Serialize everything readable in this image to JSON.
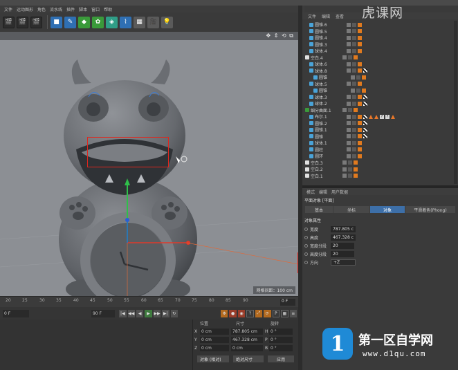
{
  "menu": [
    "文件",
    "运动图形",
    "角色",
    "流水线",
    "插件",
    "脚本",
    "窗口",
    "帮助"
  ],
  "toolbar_icons": [
    "render-view-icon",
    "render-settings-icon",
    "render-picture-viewer-icon",
    "cube-icon",
    "pen-icon",
    "subdivision-icon",
    "array-icon",
    "deformer-icon",
    "scene-icon",
    "camera-icon",
    "light-icon"
  ],
  "viewport": {
    "nav_icons": "✥ ⇕ ⟲ ⧉",
    "grid_label": "网格间距：100 cm"
  },
  "timeline": {
    "ticks": [
      "20",
      "25",
      "30",
      "35",
      "40",
      "45",
      "50",
      "55",
      "60",
      "65",
      "70",
      "75",
      "80",
      "85",
      "90"
    ],
    "frame": "0 F"
  },
  "transport": {
    "start": "0 F",
    "end": "90 F",
    "buttons": [
      "|◀",
      "◀◀",
      "◀",
      "▶",
      "▶▶",
      "▶|",
      "↻"
    ]
  },
  "coordinates": {
    "headers": {
      "position": "位置",
      "size": "尺寸",
      "rotation": "旋转"
    },
    "rows": [
      {
        "axis": "X",
        "pos": "0 cm",
        "size": "787.805 cm",
        "rot_axis": "H",
        "rot": "0 °"
      },
      {
        "axis": "Y",
        "pos": "0 cm",
        "size": "467.328 cm",
        "rot_axis": "P",
        "rot": "0 °"
      },
      {
        "axis": "Z",
        "pos": "0 cm",
        "size": "0 cm",
        "rot_axis": "B",
        "rot": "0 °"
      }
    ],
    "mode": "对象 (相对)",
    "size_mode": "绝对尺寸",
    "apply": "应用"
  },
  "object_manager": {
    "tabs": [
      "文件",
      "编辑",
      "查看"
    ],
    "rows": [
      {
        "name": "圆锥.6",
        "indent": 1,
        "color": "#4aa3d8",
        "extra": []
      },
      {
        "name": "圆锥.5",
        "indent": 1,
        "color": "#4aa3d8",
        "extra": []
      },
      {
        "name": "圆锥.4",
        "indent": 1,
        "color": "#4aa3d8",
        "extra": []
      },
      {
        "name": "圆锥.3",
        "indent": 1,
        "color": "#4aa3d8",
        "extra": []
      },
      {
        "name": "球体.4",
        "indent": 1,
        "color": "#4aa3d8",
        "extra": []
      },
      {
        "name": "空白.4",
        "indent": 0,
        "color": "#e0e0e0",
        "extra": []
      },
      {
        "name": "球体.6",
        "indent": 1,
        "color": "#4aa3d8",
        "extra": []
      },
      {
        "name": "球体.8",
        "indent": 1,
        "color": "#4aa3d8",
        "extra": [
          "checker"
        ]
      },
      {
        "name": "圆锥",
        "indent": 2,
        "color": "#4aa3d8",
        "extra": []
      },
      {
        "name": "球体.5",
        "indent": 1,
        "color": "#4aa3d8",
        "extra": []
      },
      {
        "name": "圆锥",
        "indent": 2,
        "color": "#4aa3d8",
        "extra": []
      },
      {
        "name": "球体.3",
        "indent": 1,
        "color": "#4aa3d8",
        "extra": [
          "checker"
        ]
      },
      {
        "name": "球体.2",
        "indent": 1,
        "color": "#4aa3d8",
        "extra": [
          "checker"
        ]
      },
      {
        "name": "细分曲面.1",
        "indent": 0,
        "color": "#3a9a3a",
        "extra": []
      },
      {
        "name": "布尔.1",
        "indent": 1,
        "color": "#4aa3d8",
        "extra": [
          "checker",
          "tri",
          "tri",
          "q",
          "q",
          "tri"
        ]
      },
      {
        "name": "圆锥.2",
        "indent": 1,
        "color": "#4aa3d8",
        "extra": [
          "checker"
        ]
      },
      {
        "name": "圆锥.1",
        "indent": 1,
        "color": "#4aa3d8",
        "extra": [
          "checker"
        ]
      },
      {
        "name": "圆锥",
        "indent": 1,
        "color": "#4aa3d8",
        "extra": [
          "checker"
        ]
      },
      {
        "name": "球体.1",
        "indent": 1,
        "color": "#4aa3d8",
        "extra": []
      },
      {
        "name": "圆柱",
        "indent": 1,
        "color": "#4aa3d8",
        "extra": []
      },
      {
        "name": "圆环",
        "indent": 1,
        "color": "#4aa3d8",
        "extra": []
      },
      {
        "name": "空白.3",
        "indent": 0,
        "color": "#e0e0e0",
        "extra": []
      },
      {
        "name": "空白.2",
        "indent": 0,
        "color": "#e0e0e0",
        "extra": []
      },
      {
        "name": "空白.1",
        "indent": 0,
        "color": "#e0e0e0",
        "extra": []
      }
    ]
  },
  "attribute_manager": {
    "tabs": [
      "模式",
      "编辑",
      "用户数据"
    ],
    "title": "平面对象 [平面]",
    "subtabs": [
      "基本",
      "坐标",
      "对象",
      "平滑着色(Phong)"
    ],
    "active_subtab": 2,
    "section": "对象属性",
    "props": [
      {
        "label": "宽度",
        "value": "787.805 c"
      },
      {
        "label": "高度",
        "value": "467.328 c"
      },
      {
        "label": "宽度分段",
        "value": "20"
      },
      {
        "label": "高度分段",
        "value": "20"
      },
      {
        "label": "方向",
        "value": "+Z"
      }
    ]
  },
  "watermarks": {
    "top": "虎课网",
    "brand": "第一区自学网",
    "url": "www.d1qu.com",
    "logo_char": "1"
  },
  "colors": {
    "highlight": "#e0261d",
    "active_tab": "#3d6fa8"
  }
}
